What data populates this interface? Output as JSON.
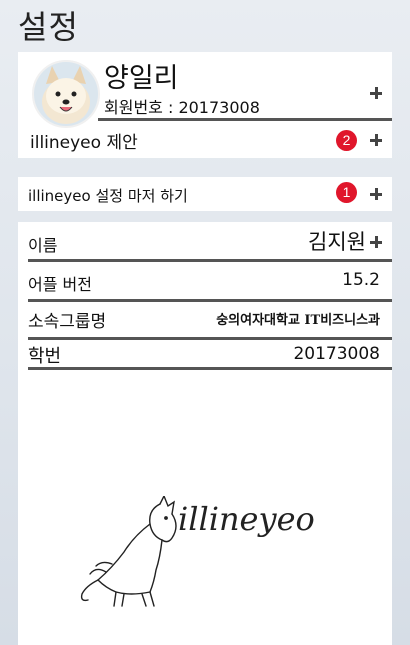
{
  "header": {
    "title": "설정"
  },
  "profile": {
    "name": "양일리",
    "member_label": "회원번호 : 20173008"
  },
  "suggest": {
    "label": "illineyeo 제안",
    "badge": "2"
  },
  "master": {
    "label": "illineyeo 설정 마저 하기",
    "badge": "1"
  },
  "info": {
    "rows": [
      {
        "label": "이름",
        "value": "김지원"
      },
      {
        "label": "어플 버전",
        "value": "15.2"
      },
      {
        "label": "소속그룹명",
        "value": "숭의여자대학교 IT비즈니스과"
      },
      {
        "label": "학번",
        "value": "20173008"
      }
    ]
  },
  "brand": {
    "logo_text": "illineyeo"
  },
  "icons": {
    "expand": "plus-icon",
    "avatar": "dog-avatar",
    "logo": "dog-line-logo"
  },
  "colors": {
    "badge": "#e0162b",
    "background": "#e3e8ee",
    "card": "#ffffff"
  }
}
